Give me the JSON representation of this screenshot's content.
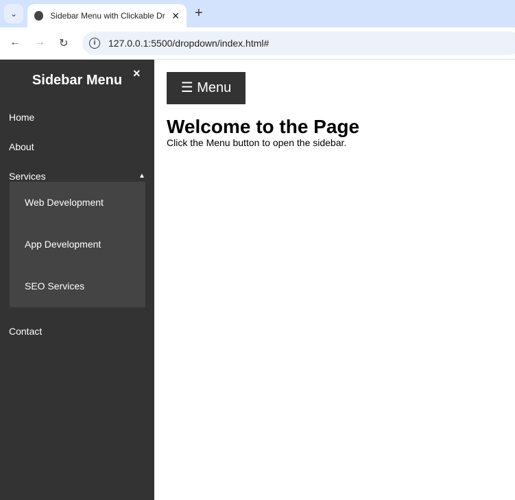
{
  "browser": {
    "tab_title": "Sidebar Menu with Clickable Dr",
    "url": "127.0.0.1:5500/dropdown/index.html#"
  },
  "sidebar": {
    "title": "Sidebar Menu",
    "close": "×",
    "items": [
      {
        "label": "Home"
      },
      {
        "label": "About"
      },
      {
        "label": "Services"
      },
      {
        "label": "Contact"
      }
    ],
    "services_caret": "▲",
    "dropdown": [
      {
        "label": "Web Development"
      },
      {
        "label": "App Development"
      },
      {
        "label": "SEO Services"
      }
    ]
  },
  "main": {
    "menu_button": "☰ Menu",
    "heading": "Welcome to the Page",
    "text": "Click the Menu button to open the sidebar."
  },
  "colors": {
    "sidebar": "#333333",
    "dropdown": "#444444",
    "tabbar": "#d3e3fd"
  }
}
